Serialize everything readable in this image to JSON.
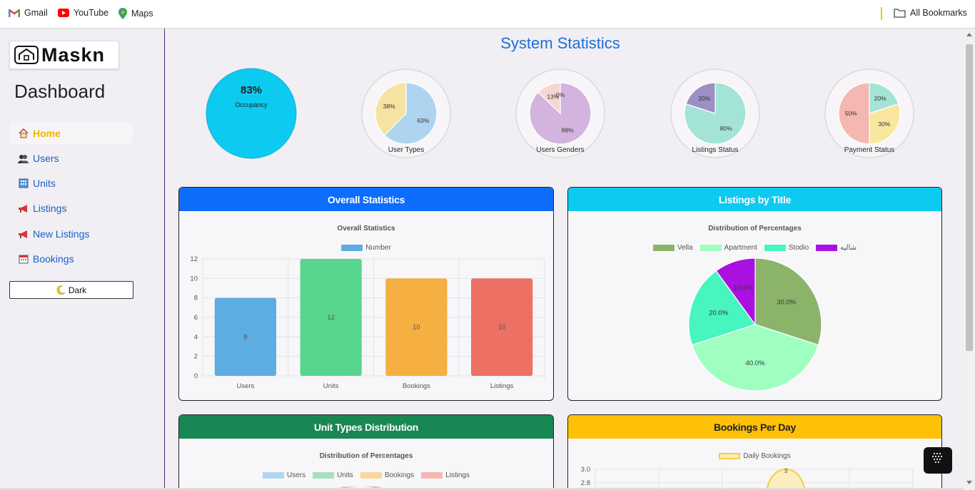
{
  "bookmarks": {
    "items": [
      {
        "label": "Gmail",
        "icon": "gmail-icon"
      },
      {
        "label": "YouTube",
        "icon": "youtube-icon"
      },
      {
        "label": "Maps",
        "icon": "maps-icon"
      }
    ],
    "all_label": "All Bookmarks"
  },
  "sidebar": {
    "logo_text": "Maskn",
    "title": "Dashboard",
    "items": [
      {
        "label": "Home",
        "icon": "home-icon",
        "active": true
      },
      {
        "label": "Users",
        "icon": "users-icon"
      },
      {
        "label": "Units",
        "icon": "building-icon"
      },
      {
        "label": "Listings",
        "icon": "megaphone-icon"
      },
      {
        "label": "New Listings",
        "icon": "megaphone-icon"
      },
      {
        "label": "Bookings",
        "icon": "calendar-icon"
      }
    ],
    "dark_button": "Dark",
    "dark_icon": "moon-icon"
  },
  "main": {
    "title": "System Statistics",
    "occupancy": {
      "value": "83%",
      "label": "Occupancy"
    },
    "mini_pies": [
      {
        "label": "User Types",
        "slices": [
          {
            "value": 63,
            "text": "63%",
            "color": "#aed4f0"
          },
          {
            "value": 38,
            "text": "38%",
            "color": "#f7e3a1"
          }
        ]
      },
      {
        "label": "Users Genders",
        "slices": [
          {
            "value": 88,
            "text": "88%",
            "color": "#d2b4de"
          },
          {
            "value": 13,
            "text": "13%",
            "color": "#f4d6d2"
          },
          {
            "value": 0,
            "text": "0%",
            "color": "#fde2e4"
          }
        ]
      },
      {
        "label": "Listings Status",
        "slices": [
          {
            "value": 80,
            "text": "80%",
            "color": "#a3e4d7"
          },
          {
            "value": 20,
            "text": "20%",
            "color": "#9b8fc4"
          }
        ]
      },
      {
        "label": "Payment Status",
        "slices": [
          {
            "value": 20,
            "text": "20%",
            "color": "#a3e4d7"
          },
          {
            "value": 30,
            "text": "30%",
            "color": "#f9e79f"
          },
          {
            "value": 50,
            "text": "50%",
            "color": "#f5b7b1"
          }
        ]
      }
    ]
  },
  "cards": {
    "overall": {
      "header": "Overall Statistics",
      "color": "#0d6efd"
    },
    "listings_title": {
      "header": "Listings by Title",
      "color": "#0dcaf0"
    },
    "unit_types": {
      "header": "Unit Types Distribution",
      "color": "#198754"
    },
    "bookings_day": {
      "header": "Bookings Per Day",
      "color": "#ffc107"
    }
  },
  "chart_data": [
    {
      "type": "bar",
      "title": "Overall Statistics",
      "categories": [
        "Users",
        "Units",
        "Bookings",
        "Listings"
      ],
      "series": [
        {
          "name": "Number",
          "values": [
            8,
            12,
            10,
            10
          ]
        }
      ],
      "colors": [
        "#5dade2",
        "#58d68d",
        "#f5b041",
        "#ec7063"
      ],
      "ylim": [
        0,
        12
      ],
      "yticks": [
        "0",
        "2",
        "4",
        "6",
        "8",
        "10",
        "12"
      ],
      "grid": true,
      "legend": "top"
    },
    {
      "type": "pie",
      "title": "Distribution of Percentages",
      "categories": [
        "Vella",
        "Apartment",
        "Stodio",
        "شاليه"
      ],
      "values": [
        30,
        40,
        20,
        10
      ],
      "labels": [
        "30.0%",
        "40.0%",
        "20.0%",
        "10.0%"
      ],
      "colors": [
        "#8bb46a",
        "#9effc1",
        "#47f5bf",
        "#aa10e0"
      ],
      "legend": "top"
    },
    {
      "type": "pie",
      "title": "Distribution of Percentages",
      "categories": [
        "Users",
        "Units",
        "Bookings",
        "Listings"
      ],
      "colors": [
        "#aed6f1",
        "#a9dfbf",
        "#fad7a0",
        "#f5b7b1"
      ],
      "legend": "top"
    },
    {
      "type": "line",
      "series": [
        {
          "name": "Daily Bookings",
          "values": [
            3
          ]
        }
      ],
      "yticks": [
        "3.0",
        "2.8"
      ],
      "point_labels": [
        "3"
      ],
      "colors": [
        "#f4d03f"
      ],
      "legend": "top"
    }
  ]
}
